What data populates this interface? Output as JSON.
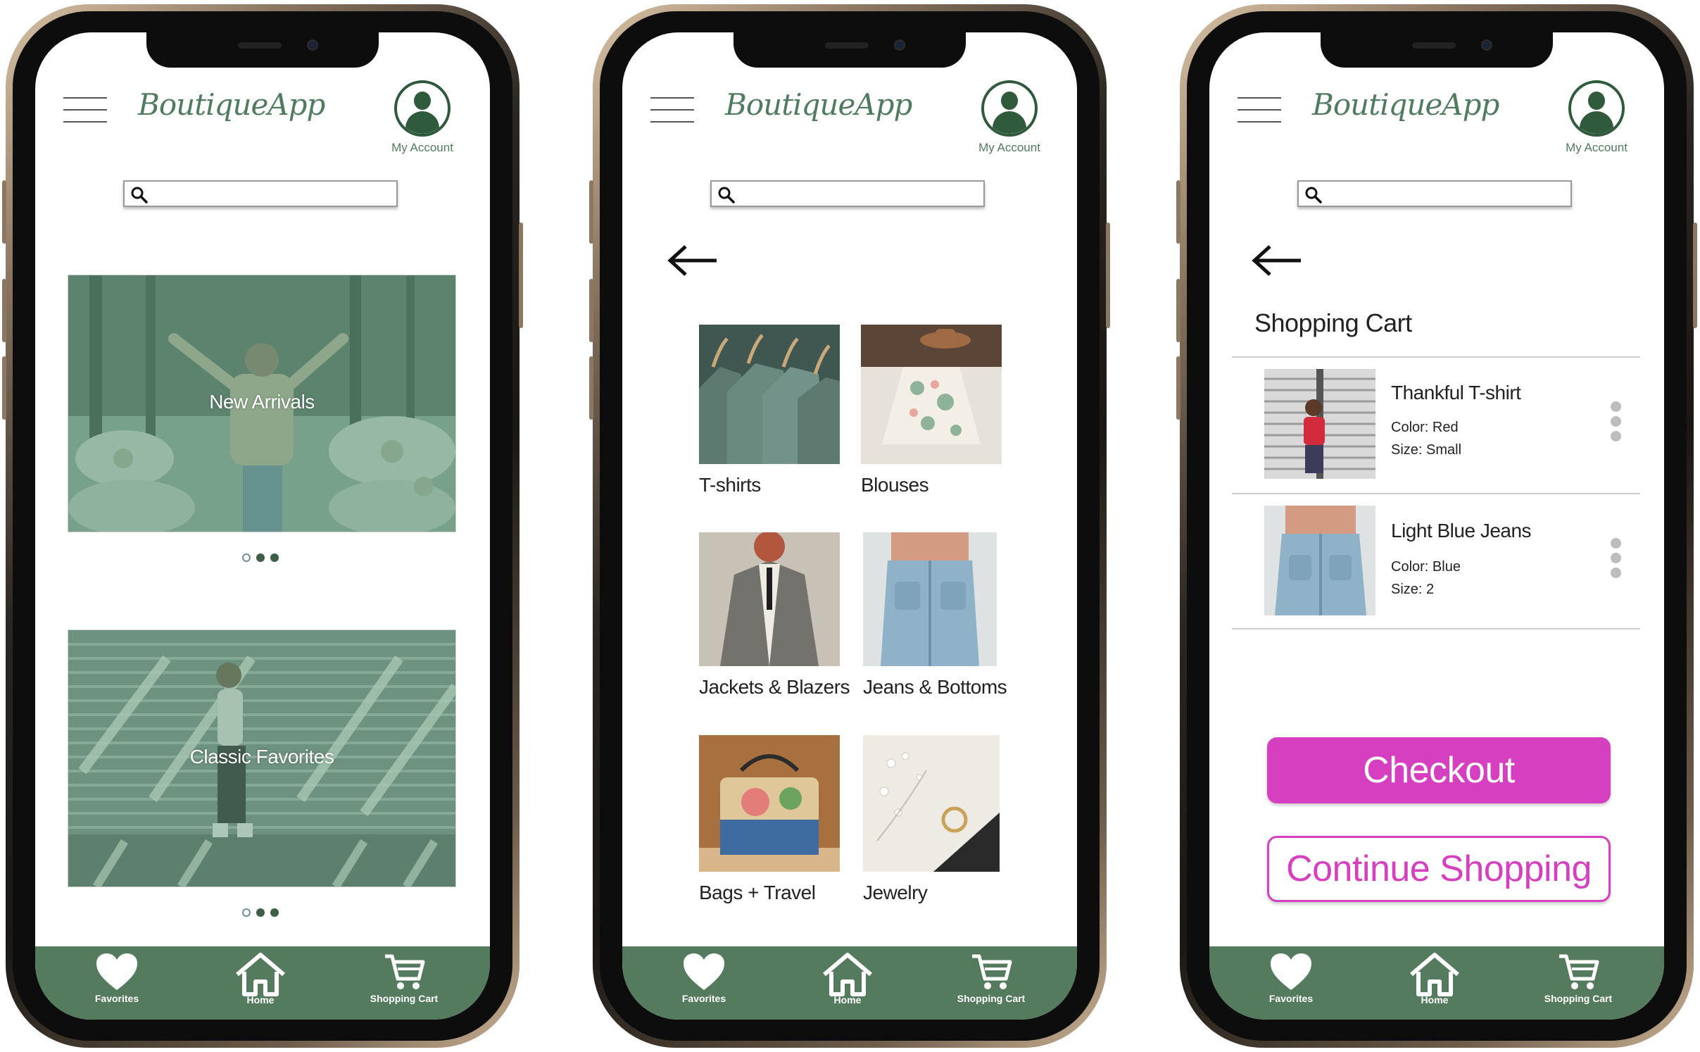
{
  "app": {
    "brand": "BoutiqueApp",
    "account_label": "My Account"
  },
  "nav": {
    "favorites": "Favorites",
    "home": "Home",
    "cart": "Shopping Cart"
  },
  "home_screen": {
    "banners": [
      {
        "caption": "New Arrivals"
      },
      {
        "caption": "Classic Favorites"
      }
    ]
  },
  "categories_screen": {
    "categories": [
      {
        "label": "T-shirts"
      },
      {
        "label": "Blouses"
      },
      {
        "label": "Jackets & Blazers"
      },
      {
        "label": "Jeans & Bottoms"
      },
      {
        "label": "Bags + Travel"
      },
      {
        "label": "Jewelry"
      }
    ]
  },
  "cart_screen": {
    "title": "Shopping Cart",
    "items": [
      {
        "name": "Thankful T-shirt",
        "color": "Color: Red",
        "size": "Size: Small"
      },
      {
        "name": "Light Blue Jeans",
        "color": "Color: Blue",
        "size": "Size: 2"
      }
    ],
    "checkout_label": "Checkout",
    "continue_label": "Continue Shopping"
  },
  "colors": {
    "brand_green": "#557b5e",
    "accent_magenta": "#d63fc0"
  },
  "icons": [
    "menu-icon",
    "account-icon",
    "search-icon",
    "back-arrow-icon",
    "more-vertical-icon",
    "heart-icon",
    "home-icon",
    "cart-icon"
  ]
}
